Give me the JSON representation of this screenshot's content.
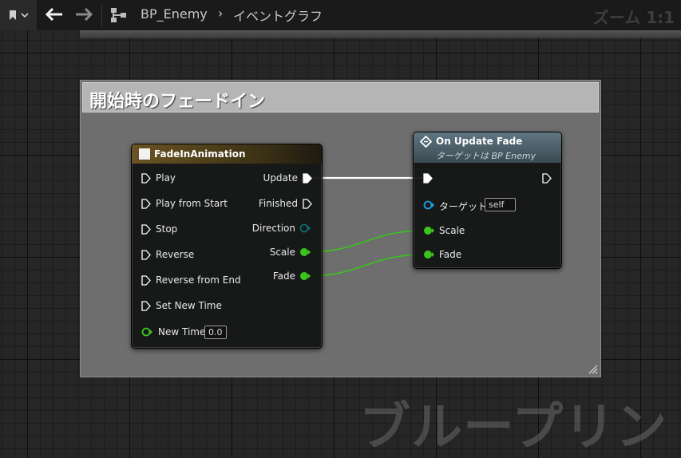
{
  "toolbar": {
    "breadcrumb_blueprint": "BP_Enemy",
    "breadcrumb_graph": "イベントグラフ",
    "zoom": "ズーム 1:1",
    "icons": [
      "bookmark-icon",
      "chevron-down-icon",
      "back-arrow-icon",
      "forward-arrow-icon",
      "blueprint-graph-icon"
    ]
  },
  "comment": {
    "title": "開始時のフェードイン"
  },
  "timeline_node": {
    "title": "FadeInAnimation",
    "inputs": [
      "Play",
      "Play from Start",
      "Stop",
      "Reverse",
      "Reverse from End",
      "Set New Time"
    ],
    "new_time_label": "New Time",
    "new_time_value": "0.0",
    "outputs": [
      "Update",
      "Finished",
      "Direction",
      "Scale",
      "Fade"
    ]
  },
  "event_node": {
    "title": "On Update Fade",
    "subtitle": "ターゲットは BP Enemy",
    "target_label": "ターゲット",
    "target_value": "self",
    "inputs": [
      "Scale",
      "Fade"
    ]
  },
  "watermark": "ブループリント",
  "colors": {
    "exec": "#ffffff",
    "float_pin": "#39c51b",
    "object_pin": "#1aa3e6",
    "struct_pin": "#0e6b6b",
    "timeline_header": "#6a5424",
    "event_header": "#5f7682"
  }
}
